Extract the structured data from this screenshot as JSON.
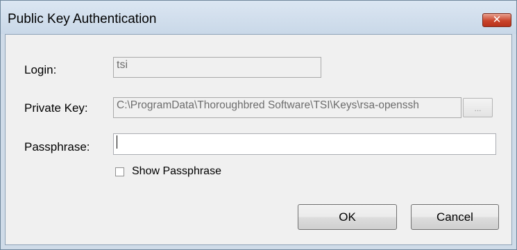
{
  "window": {
    "title": "Public Key Authentication",
    "close_label": "✕"
  },
  "form": {
    "login": {
      "label": "Login:",
      "value": "tsi"
    },
    "private_key": {
      "label": "Private Key:",
      "value": "C:\\ProgramData\\Thoroughbred Software\\TSI\\Keys\\rsa-openssh",
      "browse_label": "..."
    },
    "passphrase": {
      "label": "Passphrase:",
      "value": ""
    },
    "show_passphrase": {
      "label": "Show Passphrase",
      "checked": false
    }
  },
  "buttons": {
    "ok": "OK",
    "cancel": "Cancel"
  }
}
